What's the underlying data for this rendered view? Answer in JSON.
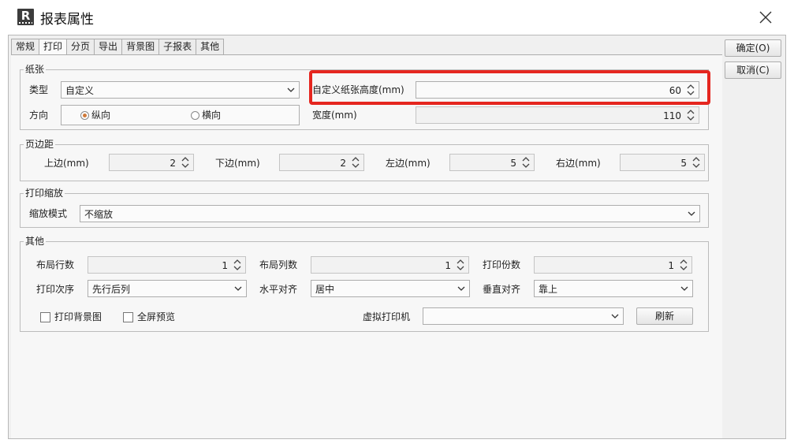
{
  "window": {
    "title": "报表属性",
    "app_icon_letter": "R"
  },
  "tabs": [
    "常规",
    "打印",
    "分页",
    "导出",
    "背景图",
    "子报表",
    "其他"
  ],
  "active_tab": "打印",
  "buttons": {
    "ok": "确定(O)",
    "cancel": "取消(C)",
    "refresh": "刷新"
  },
  "paper": {
    "legend": "纸张",
    "type_label": "类型",
    "type_value": "自定义",
    "orientation_label": "方向",
    "portrait": "纵向",
    "landscape": "横向",
    "selected": "portrait",
    "height_label": "自定义纸张高度(mm)",
    "height_value": "60",
    "width_label": "宽度(mm)",
    "width_value": "110"
  },
  "margins": {
    "legend": "页边距",
    "top_label": "上边(mm)",
    "top_value": "2",
    "bottom_label": "下边(mm)",
    "bottom_value": "2",
    "left_label": "左边(mm)",
    "left_value": "5",
    "right_label": "右边(mm)",
    "right_value": "5"
  },
  "scale": {
    "legend": "打印缩放",
    "mode_label": "缩放模式",
    "mode_value": "不缩放"
  },
  "other": {
    "legend": "其他",
    "rows_label": "布局行数",
    "rows_value": "1",
    "cols_label": "布局列数",
    "cols_value": "1",
    "copies_label": "打印份数",
    "copies_value": "1",
    "order_label": "打印次序",
    "order_value": "先行后列",
    "halign_label": "水平对齐",
    "halign_value": "居中",
    "valign_label": "垂直对齐",
    "valign_value": "靠上",
    "print_bg_label": "打印背景图",
    "print_bg_checked": false,
    "fullscreen_label": "全屏预览",
    "fullscreen_checked": false,
    "printer_label": "虚拟打印机",
    "printer_value": ""
  },
  "colors": {
    "highlight": "#e5261f",
    "radio_dot": "#d07a3a"
  }
}
